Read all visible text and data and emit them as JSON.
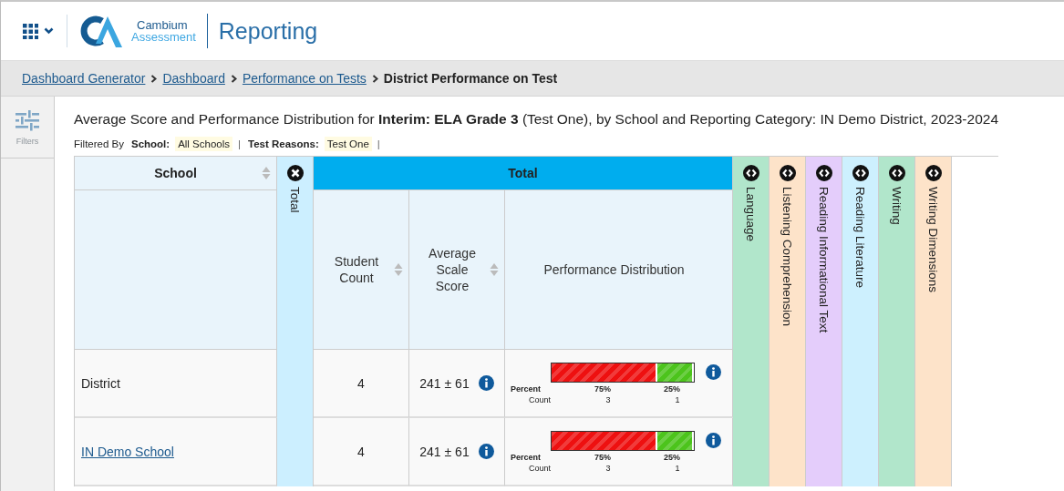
{
  "header": {
    "logo_name": "Cambium",
    "logo_subname": "Assessment",
    "app_title": "Reporting"
  },
  "breadcrumbs": [
    {
      "label": "Dashboard Generator",
      "link": true
    },
    {
      "label": "Dashboard",
      "link": true
    },
    {
      "label": "Performance on Tests",
      "link": true
    },
    {
      "label": "District Performance on Test",
      "link": false
    }
  ],
  "sidebar": {
    "filters_label": "Filters"
  },
  "report_title": "Average Score and Performance Distribution for **Interim: ELA Grade 3** (Test One), by School and Reporting Category: IN Demo District, 2023-2024",
  "filters": {
    "prefix": "Filtered By",
    "separator": "|",
    "items": [
      {
        "label": "School:",
        "value": "All Schools"
      },
      {
        "label": "Test Reasons:",
        "value": "Test One"
      }
    ]
  },
  "table": {
    "school_header": "School",
    "collapsed_group": {
      "label": "Total",
      "color": "#ccefff"
    },
    "group": {
      "label": "Total",
      "color": "#00adee"
    },
    "columns": [
      {
        "label": "Student Count",
        "sortable": true
      },
      {
        "label": "Average Scale Score",
        "sortable": true
      },
      {
        "label": "Performance Distribution",
        "sortable": false
      }
    ],
    "categories": [
      {
        "label": "Language",
        "color": "#b1e6cb"
      },
      {
        "label": "Listening Comprehension",
        "color": "#fde3c9"
      },
      {
        "label": "Reading Informational Text",
        "color": "#e4cdfb"
      },
      {
        "label": "Reading Literature",
        "color": "#cdf0fe"
      },
      {
        "label": "Writing",
        "color": "#b1e6cb"
      },
      {
        "label": "Writing Dimensions",
        "color": "#fde3c9"
      }
    ],
    "rows": [
      {
        "school": "District",
        "link": false,
        "student_count": "4",
        "average_score": "241 ± 61",
        "distribution": {
          "percent_label": "Percent",
          "count_label": "Count",
          "segments": [
            {
              "percent": "75%",
              "count": "3",
              "level": 0.75,
              "color": "#ee1010"
            },
            {
              "percent": "25%",
              "count": "1",
              "level": 0.25,
              "color": "#4cc41c"
            }
          ]
        }
      },
      {
        "school": "IN Demo School",
        "link": true,
        "student_count": "4",
        "average_score": "241 ± 61",
        "distribution": {
          "percent_label": "Percent",
          "count_label": "Count",
          "segments": [
            {
              "percent": "75%",
              "count": "3",
              "level": 0.75,
              "color": "#ee1010"
            },
            {
              "percent": "25%",
              "count": "1",
              "level": 0.25,
              "color": "#4cc41c"
            }
          ]
        }
      }
    ]
  }
}
